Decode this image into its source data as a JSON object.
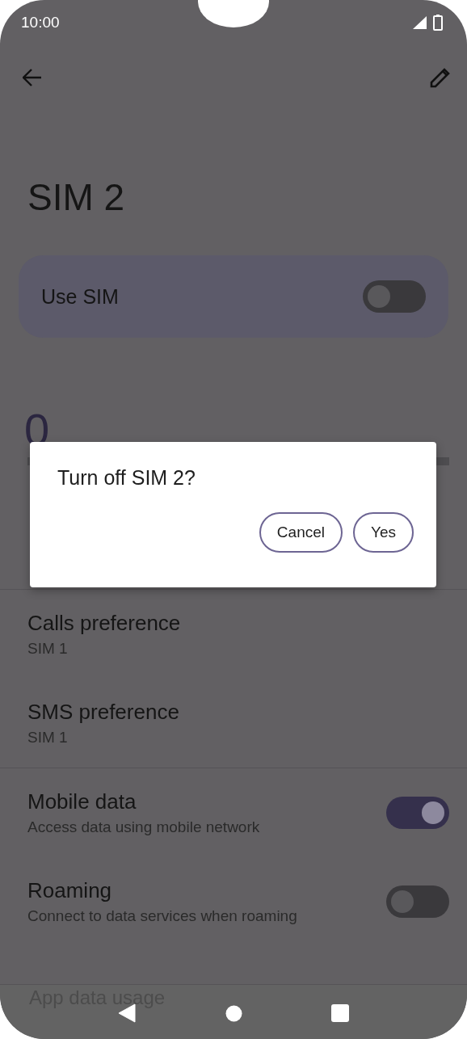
{
  "status_bar": {
    "time": "10:00"
  },
  "title": "SIM 2",
  "use_sim": {
    "label": "Use SIM",
    "on": false
  },
  "data_usage": {
    "amount": "0"
  },
  "preferences": [
    {
      "title": "Calls preference",
      "value": "SIM 1"
    },
    {
      "title": "SMS preference",
      "value": "SIM 1"
    }
  ],
  "toggles": [
    {
      "title": "Mobile data",
      "subtitle": "Access data using mobile network",
      "on": true
    },
    {
      "title": "Roaming",
      "subtitle": "Connect to data services when roaming",
      "on": false
    }
  ],
  "footer_hint": "App data usage",
  "dialog": {
    "title": "Turn off SIM 2?",
    "buttons": [
      "Cancel",
      "Yes"
    ]
  }
}
